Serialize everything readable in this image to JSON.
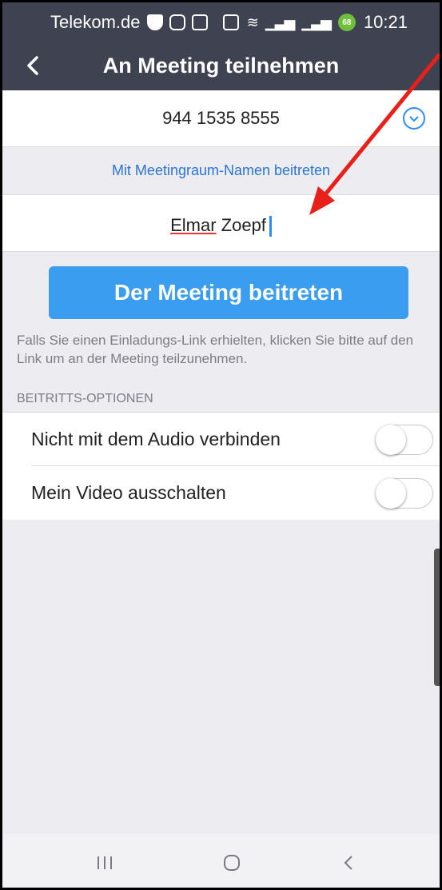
{
  "status": {
    "carrier": "Telekom.de",
    "battery": "68",
    "time": "10:21"
  },
  "header": {
    "title": "An Meeting teilnehmen"
  },
  "meeting_id": {
    "value": "944 1535 8555"
  },
  "room_link": "Mit Meetingraum-Namen beitreten",
  "name_field": {
    "first": "Elmar",
    "last": "Zoepf"
  },
  "join_button": "Der Meeting beitreten",
  "hint": "Falls Sie einen Einladungs-Link erhielten, klicken Sie bitte auf den Link um an der Meeting teilzunehmen.",
  "options": {
    "header": "BEITRITTS-OPTIONEN",
    "items": [
      {
        "label": "Nicht mit dem Audio verbinden",
        "on": false
      },
      {
        "label": "Mein Video ausschalten",
        "on": false
      }
    ]
  },
  "colors": {
    "header_bg": "#3f4351",
    "accent": "#3a9df0",
    "link": "#2b73d6",
    "annotation_arrow": "#e8201a"
  },
  "icons": {
    "back": "back-chevron-icon",
    "dropdown": "chevron-down-icon",
    "sysnav": [
      "recent-apps-icon",
      "home-icon",
      "back-icon"
    ]
  }
}
